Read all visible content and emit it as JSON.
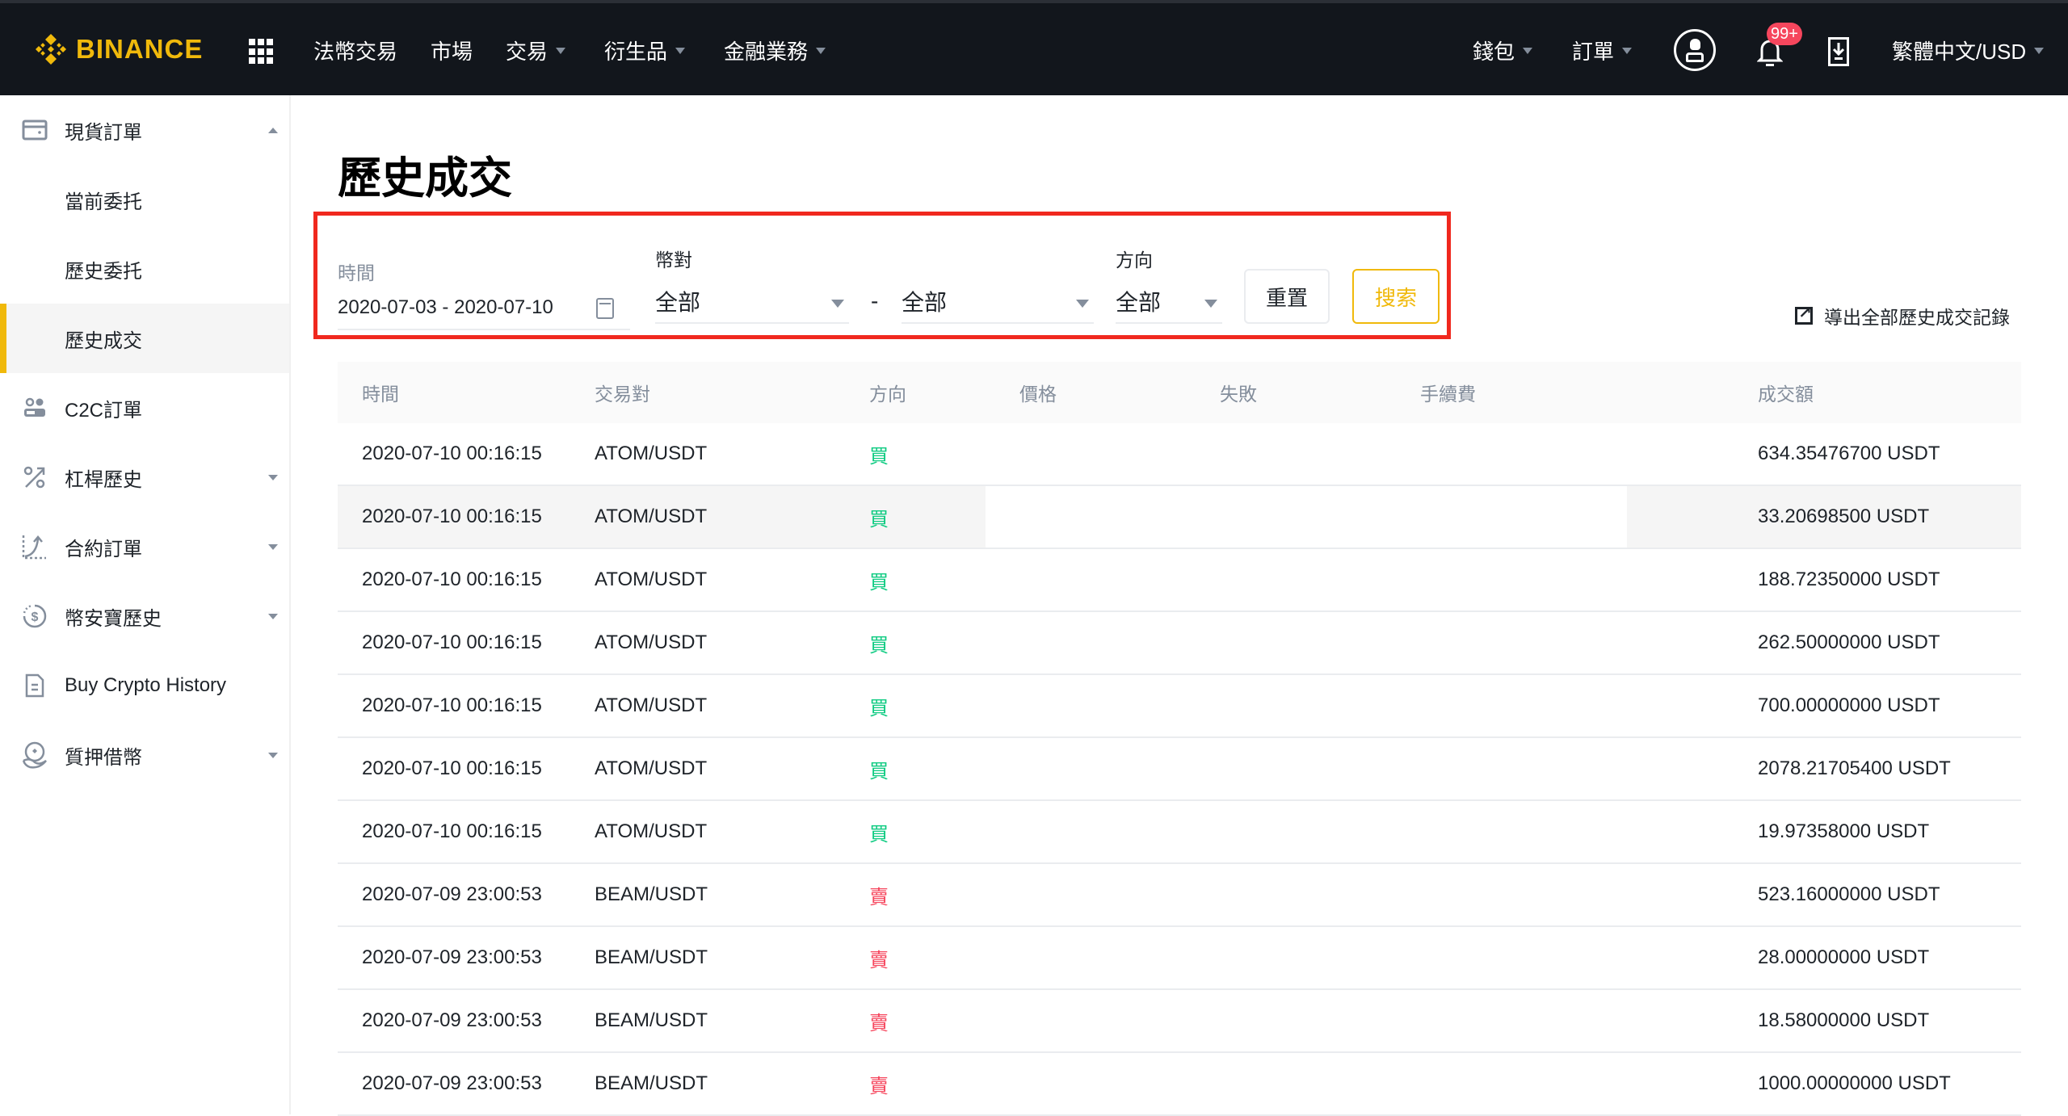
{
  "header": {
    "brand": "BINANCE",
    "nav": [
      {
        "label": "法幣交易",
        "dropdown": false
      },
      {
        "label": "市場",
        "dropdown": false
      },
      {
        "label": "交易",
        "dropdown": true
      },
      {
        "label": "衍生品",
        "dropdown": true
      },
      {
        "label": "金融業務",
        "dropdown": true
      }
    ],
    "right_nav": [
      {
        "label": "錢包",
        "dropdown": true
      },
      {
        "label": "訂單",
        "dropdown": true
      }
    ],
    "notification_badge": "99+",
    "language": "繁體中文/USD",
    "colors": {
      "brand": "#F0B90B",
      "bg": "#12161C",
      "badge": "#F6465D"
    }
  },
  "sidebar": {
    "items": [
      {
        "label": "現貨訂單",
        "icon": "wallet-icon",
        "arrow": "up",
        "level": 0
      },
      {
        "label": "當前委托",
        "level": 1
      },
      {
        "label": "歷史委托",
        "level": 1
      },
      {
        "label": "歷史成交",
        "level": 1,
        "active": true
      },
      {
        "label": "C2C訂單",
        "icon": "users-icon",
        "level": 0
      },
      {
        "label": "杠桿歷史",
        "icon": "percent-icon",
        "arrow": "down",
        "level": 0
      },
      {
        "label": "合約訂單",
        "icon": "futures-icon",
        "arrow": "down",
        "level": 0
      },
      {
        "label": "幣安寶歷史",
        "icon": "savings-icon",
        "arrow": "down",
        "level": 0
      },
      {
        "label": "Buy Crypto History",
        "icon": "document-icon",
        "level": 0
      },
      {
        "label": "質押借幣",
        "icon": "loan-icon",
        "arrow": "down",
        "level": 0
      }
    ]
  },
  "page": {
    "title": "歷史成交",
    "filters": {
      "time_label": "時間",
      "time_value": "2020-07-03 - 2020-07-10",
      "pair_label": "幣對",
      "pair_base": "全部",
      "pair_separator": "-",
      "pair_quote": "全部",
      "side_label": "方向",
      "side_value": "全部",
      "reset_label": "重置",
      "search_label": "搜索"
    },
    "export_label": "導出全部歷史成交記錄"
  },
  "table": {
    "columns": [
      "時間",
      "交易對",
      "方向",
      "價格",
      "失敗",
      "手續費",
      "成交額"
    ],
    "rows": [
      {
        "time": "2020-07-10 00:16:15",
        "pair": "ATOM/USDT",
        "side": "買",
        "side_type": "buy",
        "amount": "634.35476700 USDT"
      },
      {
        "time": "2020-07-10 00:16:15",
        "pair": "ATOM/USDT",
        "side": "買",
        "side_type": "buy",
        "amount": "33.20698500 USDT"
      },
      {
        "time": "2020-07-10 00:16:15",
        "pair": "ATOM/USDT",
        "side": "買",
        "side_type": "buy",
        "amount": "188.72350000 USDT"
      },
      {
        "time": "2020-07-10 00:16:15",
        "pair": "ATOM/USDT",
        "side": "買",
        "side_type": "buy",
        "amount": "262.50000000 USDT"
      },
      {
        "time": "2020-07-10 00:16:15",
        "pair": "ATOM/USDT",
        "side": "買",
        "side_type": "buy",
        "amount": "700.00000000 USDT"
      },
      {
        "time": "2020-07-10 00:16:15",
        "pair": "ATOM/USDT",
        "side": "買",
        "side_type": "buy",
        "amount": "2078.21705400 USDT"
      },
      {
        "time": "2020-07-10 00:16:15",
        "pair": "ATOM/USDT",
        "side": "買",
        "side_type": "buy",
        "amount": "19.97358000 USDT"
      },
      {
        "time": "2020-07-09 23:00:53",
        "pair": "BEAM/USDT",
        "side": "賣",
        "side_type": "sell",
        "amount": "523.16000000 USDT"
      },
      {
        "time": "2020-07-09 23:00:53",
        "pair": "BEAM/USDT",
        "side": "賣",
        "side_type": "sell",
        "amount": "28.00000000 USDT"
      },
      {
        "time": "2020-07-09 23:00:53",
        "pair": "BEAM/USDT",
        "side": "賣",
        "side_type": "sell",
        "amount": "18.58000000 USDT"
      },
      {
        "time": "2020-07-09 23:00:53",
        "pair": "BEAM/USDT",
        "side": "賣",
        "side_type": "sell",
        "amount": "1000.00000000 USDT"
      }
    ]
  }
}
